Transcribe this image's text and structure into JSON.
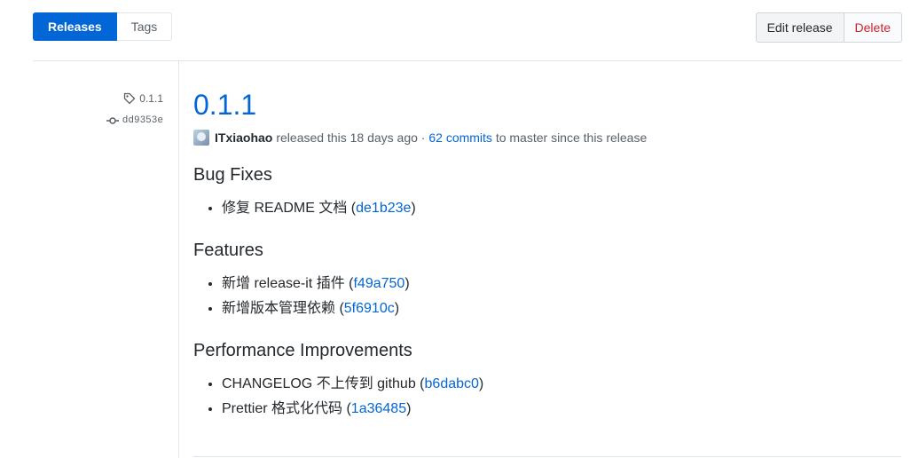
{
  "subnav": {
    "releases_label": "Releases",
    "tags_label": "Tags"
  },
  "actions": {
    "edit_label": "Edit release",
    "delete_label": "Delete"
  },
  "meta": {
    "tag": "0.1.1",
    "commit": "dd9353e"
  },
  "release": {
    "title": "0.1.1",
    "author": "ITxiaohao",
    "released_text": "released this 18 days ago ·",
    "commits_link": "62 commits",
    "since_text": "to master since this release"
  },
  "sections": [
    {
      "heading": "Bug Fixes",
      "items": [
        {
          "text": "修复 README 文档 (",
          "hash": "de1b23e",
          "close": ")"
        }
      ]
    },
    {
      "heading": "Features",
      "items": [
        {
          "text": "新增 release-it 插件 (",
          "hash": "f49a750",
          "close": ")"
        },
        {
          "text": "新增版本管理依赖 (",
          "hash": "5f6910c",
          "close": ")"
        }
      ]
    },
    {
      "heading": "Performance Improvements",
      "items": [
        {
          "text": "CHANGELOG 不上传到 github (",
          "hash": "b6dabc0",
          "close": ")"
        },
        {
          "text": "Prettier 格式化代码 (",
          "hash": "1a36485",
          "close": ")"
        }
      ]
    }
  ],
  "colors": {
    "accent": "#0366d6",
    "danger": "#cb2431",
    "text": "#24292e",
    "muted": "#586069"
  }
}
